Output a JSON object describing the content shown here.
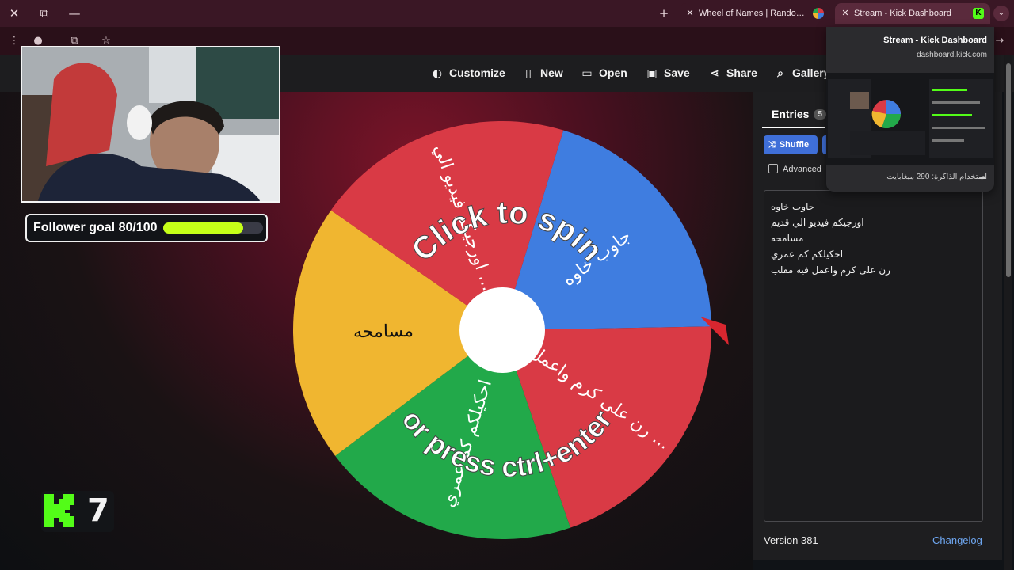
{
  "browser": {
    "window_controls": {
      "close": "✕",
      "restore": "⧉",
      "minimize": "—"
    },
    "new_tab": "+",
    "tabs": [
      {
        "title": "Wheel of Names | Random nam",
        "close": "✕"
      },
      {
        "title": "Stream - Kick Dashboard",
        "close": "✕",
        "favicon": "K"
      }
    ],
    "tab_list": "⌄"
  },
  "hover_card": {
    "title": "Stream - Kick Dashboard",
    "url": "dashboard.kick.com",
    "memory": "استخدام الذاكرة: 290 ميغابايت"
  },
  "nav": {
    "customize": "Customize",
    "new": "New",
    "open": "Open",
    "save": "Save",
    "share": "Share",
    "gallery": "Gallery"
  },
  "wheel": {
    "center_text_top": "Click to spin",
    "center_text_bottom": "or press ctrl+enter",
    "slices": [
      {
        "label": "جاوب خاوه",
        "color": "#3f7de0"
      },
      {
        "label": "رن على كرم واعمل ...",
        "color": "#d93a45"
      },
      {
        "label": "احكيلكم كم عمري",
        "color": "#22a94a"
      },
      {
        "label": "مسامحه",
        "color": "#f0b630"
      },
      {
        "label": "اورجيكم فيديو الي ...",
        "color": "#d93a45"
      }
    ]
  },
  "panel": {
    "entries_tab": "Entries",
    "entries_count": "5",
    "shuffle": "Shuffle",
    "advanced": "Advanced",
    "entries": [
      "جاوب خاوه",
      "اورجيكم فيديو الي قديم",
      "مسامحه",
      "احكيلكم كم عمري",
      "رن على كرم واعمل فيه مقلب"
    ],
    "version": "Version 381",
    "changelog": "Changelog"
  },
  "overlay": {
    "follower_goal": "Follower goal 80/100",
    "follower_progress": 0.8,
    "kick_count": "7"
  }
}
